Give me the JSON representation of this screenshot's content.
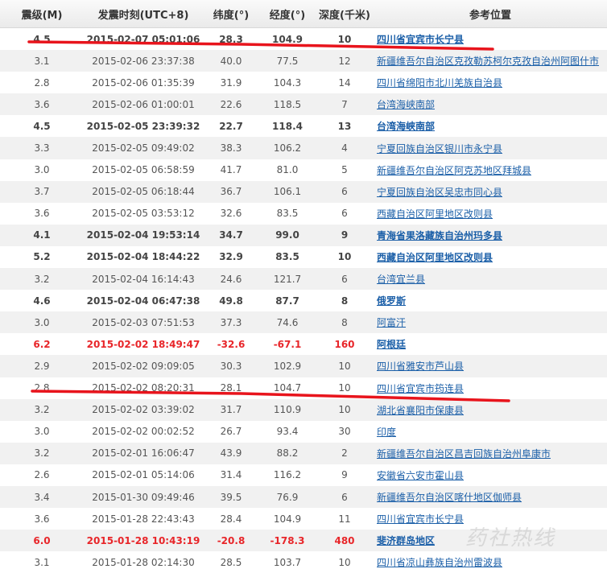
{
  "headers": {
    "magnitude": "震级(M)",
    "time": "发震时刻(UTC+8)",
    "latitude": "纬度(°)",
    "longitude": "经度(°)",
    "depth": "深度(千米)",
    "location": "参考位置"
  },
  "rows": [
    {
      "mag": "4.5",
      "time": "2015-02-07 05:01:06",
      "lat": "28.3",
      "lon": "104.9",
      "depth": "10",
      "loc": "四川省宜宾市长宁县",
      "style": "strong"
    },
    {
      "mag": "3.1",
      "time": "2015-02-06 23:37:38",
      "lat": "40.0",
      "lon": "77.5",
      "depth": "12",
      "loc": "新疆维吾尔自治区克孜勒苏柯尔克孜自治州阿图什市",
      "style": "normal"
    },
    {
      "mag": "2.8",
      "time": "2015-02-06 01:35:39",
      "lat": "31.9",
      "lon": "104.3",
      "depth": "14",
      "loc": "四川省绵阳市北川羌族自治县",
      "style": "normal"
    },
    {
      "mag": "3.6",
      "time": "2015-02-06 01:00:01",
      "lat": "22.6",
      "lon": "118.5",
      "depth": "7",
      "loc": "台湾海峡南部",
      "style": "normal"
    },
    {
      "mag": "4.5",
      "time": "2015-02-05 23:39:32",
      "lat": "22.7",
      "lon": "118.4",
      "depth": "13",
      "loc": "台湾海峡南部",
      "style": "strong"
    },
    {
      "mag": "3.3",
      "time": "2015-02-05 09:49:02",
      "lat": "38.3",
      "lon": "106.2",
      "depth": "4",
      "loc": "宁夏回族自治区银川市永宁县",
      "style": "normal"
    },
    {
      "mag": "3.0",
      "time": "2015-02-05 06:58:59",
      "lat": "41.7",
      "lon": "81.0",
      "depth": "5",
      "loc": "新疆维吾尔自治区阿克苏地区拜城县",
      "style": "normal"
    },
    {
      "mag": "3.7",
      "time": "2015-02-05 06:18:44",
      "lat": "36.7",
      "lon": "106.1",
      "depth": "6",
      "loc": "宁夏回族自治区吴忠市同心县",
      "style": "normal"
    },
    {
      "mag": "3.6",
      "time": "2015-02-05 03:53:12",
      "lat": "32.6",
      "lon": "83.5",
      "depth": "6",
      "loc": "西藏自治区阿里地区改则县",
      "style": "normal"
    },
    {
      "mag": "4.1",
      "time": "2015-02-04 19:53:14",
      "lat": "34.7",
      "lon": "99.0",
      "depth": "9",
      "loc": "青海省果洛藏族自治州玛多县",
      "style": "strong"
    },
    {
      "mag": "5.2",
      "time": "2015-02-04 18:44:22",
      "lat": "32.9",
      "lon": "83.5",
      "depth": "10",
      "loc": "西藏自治区阿里地区改则县",
      "style": "strong"
    },
    {
      "mag": "3.2",
      "time": "2015-02-04 16:14:43",
      "lat": "24.6",
      "lon": "121.7",
      "depth": "6",
      "loc": "台湾宜兰县",
      "style": "normal"
    },
    {
      "mag": "4.6",
      "time": "2015-02-04 06:47:38",
      "lat": "49.8",
      "lon": "87.7",
      "depth": "8",
      "loc": "俄罗斯",
      "style": "strong"
    },
    {
      "mag": "3.0",
      "time": "2015-02-03 07:51:53",
      "lat": "37.3",
      "lon": "74.6",
      "depth": "8",
      "loc": "阿富汗",
      "style": "normal"
    },
    {
      "mag": "6.2",
      "time": "2015-02-02 18:49:47",
      "lat": "-32.6",
      "lon": "-67.1",
      "depth": "160",
      "loc": "阿根廷",
      "style": "red"
    },
    {
      "mag": "2.9",
      "time": "2015-02-02 09:09:05",
      "lat": "30.3",
      "lon": "102.9",
      "depth": "10",
      "loc": "四川省雅安市芦山县",
      "style": "normal"
    },
    {
      "mag": "2.8",
      "time": "2015-02-02 08:20:31",
      "lat": "28.1",
      "lon": "104.7",
      "depth": "10",
      "loc": "四川省宜宾市筠连县",
      "style": "normal"
    },
    {
      "mag": "3.2",
      "time": "2015-02-02 03:39:02",
      "lat": "31.7",
      "lon": "110.9",
      "depth": "10",
      "loc": "湖北省襄阳市保康县",
      "style": "normal"
    },
    {
      "mag": "3.0",
      "time": "2015-02-02 00:02:52",
      "lat": "26.7",
      "lon": "93.4",
      "depth": "30",
      "loc": "印度",
      "style": "normal"
    },
    {
      "mag": "3.2",
      "time": "2015-02-01 16:06:47",
      "lat": "43.9",
      "lon": "88.2",
      "depth": "2",
      "loc": "新疆维吾尔自治区昌吉回族自治州阜康市",
      "style": "normal"
    },
    {
      "mag": "2.6",
      "time": "2015-02-01 05:14:06",
      "lat": "31.4",
      "lon": "116.2",
      "depth": "9",
      "loc": "安徽省六安市霍山县",
      "style": "normal"
    },
    {
      "mag": "3.4",
      "time": "2015-01-30 09:49:46",
      "lat": "39.5",
      "lon": "76.9",
      "depth": "6",
      "loc": "新疆维吾尔自治区喀什地区伽师县",
      "style": "normal"
    },
    {
      "mag": "3.6",
      "time": "2015-01-28 22:43:43",
      "lat": "28.4",
      "lon": "104.9",
      "depth": "11",
      "loc": "四川省宜宾市长宁县",
      "style": "normal"
    },
    {
      "mag": "6.0",
      "time": "2015-01-28 10:43:19",
      "lat": "-20.8",
      "lon": "-178.3",
      "depth": "480",
      "loc": "斐济群岛地区",
      "style": "red"
    },
    {
      "mag": "3.1",
      "time": "2015-01-28 02:14:30",
      "lat": "28.5",
      "lon": "103.7",
      "depth": "10",
      "loc": "四川省凉山彝族自治州雷波县",
      "style": "normal"
    }
  ],
  "annotation_color": "#e8141c",
  "watermark": "药社热线"
}
